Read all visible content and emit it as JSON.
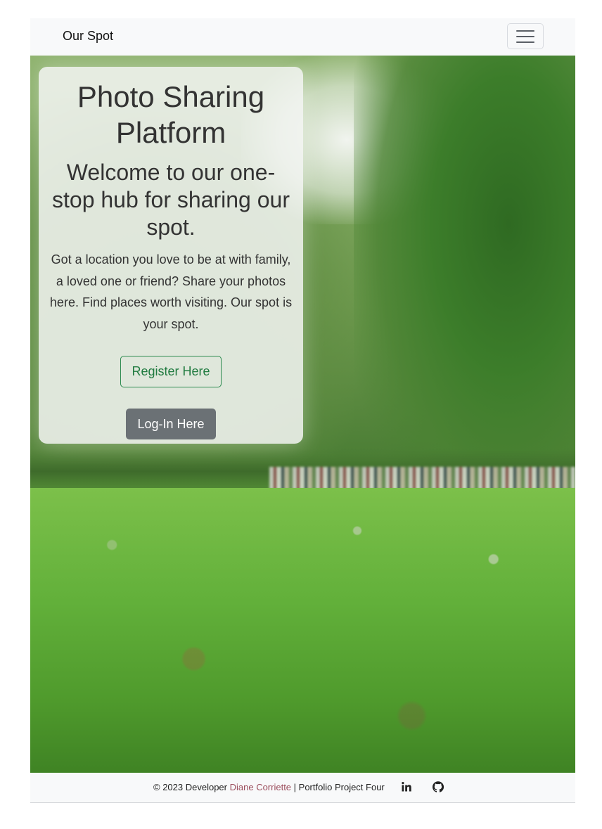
{
  "navbar": {
    "brand": "Our Spot",
    "toggler_icon": "hamburger-menu-icon"
  },
  "hero": {
    "title": "Photo Sharing Platform",
    "subtitle": "Welcome to our one-stop hub for sharing our spot.",
    "description": "Got a location you love to be at with family, a loved one or friend? Share your photos here. Find places worth visiting. Our spot is your spot.",
    "register_label": "Register Here",
    "login_label": "Log-In Here"
  },
  "footer": {
    "copyright_prefix": "© 2023 Developer",
    "developer_name": "Diane Corriette",
    "suffix": "| Portfolio Project Four",
    "social_icons": [
      "linkedin-icon",
      "github-icon"
    ]
  },
  "colors": {
    "navbar_bg": "#f8f9fa",
    "register_border": "#2e8b50",
    "login_bg": "#6b7175",
    "developer_link": "#9b4d5c"
  }
}
